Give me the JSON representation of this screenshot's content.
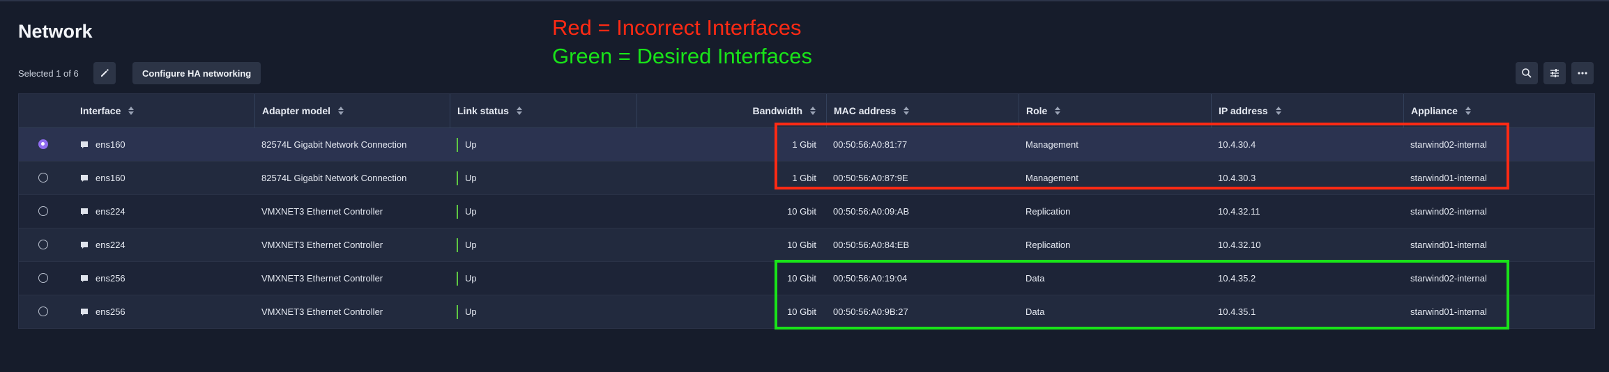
{
  "page": {
    "title": "Network",
    "selected_text": "Selected 1 of 6",
    "configure_button": "Configure HA networking"
  },
  "annotations": {
    "red": "Red = Incorrect Interfaces",
    "green": "Green = Desired Interfaces",
    "red_color": "#ff2a14",
    "green_color": "#19e319"
  },
  "icons": {
    "edit": "pencil-icon",
    "search": "search-icon",
    "filter": "sliders-icon",
    "more": "more-horizontal-icon",
    "row": "network-adapter-icon"
  },
  "columns": [
    "Interface",
    "Adapter model",
    "Link status",
    "Bandwidth",
    "MAC address",
    "Role",
    "IP address",
    "Appliance"
  ],
  "rows": [
    {
      "selected": true,
      "interface": "ens160",
      "adapter": "82574L Gigabit Network Connection",
      "link": "Up",
      "bandwidth": "1 Gbit",
      "mac": "00:50:56:A0:81:77",
      "role": "Management",
      "ip": "10.4.30.4",
      "appliance": "starwind02-internal"
    },
    {
      "selected": false,
      "interface": "ens160",
      "adapter": "82574L Gigabit Network Connection",
      "link": "Up",
      "bandwidth": "1 Gbit",
      "mac": "00:50:56:A0:87:9E",
      "role": "Management",
      "ip": "10.4.30.3",
      "appliance": "starwind01-internal"
    },
    {
      "selected": false,
      "interface": "ens224",
      "adapter": "VMXNET3 Ethernet Controller",
      "link": "Up",
      "bandwidth": "10 Gbit",
      "mac": "00:50:56:A0:09:AB",
      "role": "Replication",
      "ip": "10.4.32.11",
      "appliance": "starwind02-internal"
    },
    {
      "selected": false,
      "interface": "ens224",
      "adapter": "VMXNET3 Ethernet Controller",
      "link": "Up",
      "bandwidth": "10 Gbit",
      "mac": "00:50:56:A0:84:EB",
      "role": "Replication",
      "ip": "10.4.32.10",
      "appliance": "starwind01-internal"
    },
    {
      "selected": false,
      "interface": "ens256",
      "adapter": "VMXNET3 Ethernet Controller",
      "link": "Up",
      "bandwidth": "10 Gbit",
      "mac": "00:50:56:A0:19:04",
      "role": "Data",
      "ip": "10.4.35.2",
      "appliance": "starwind02-internal"
    },
    {
      "selected": false,
      "interface": "ens256",
      "adapter": "VMXNET3 Ethernet Controller",
      "link": "Up",
      "bandwidth": "10 Gbit",
      "mac": "00:50:56:A0:9B:27",
      "role": "Data",
      "ip": "10.4.35.1",
      "appliance": "starwind01-internal"
    }
  ]
}
